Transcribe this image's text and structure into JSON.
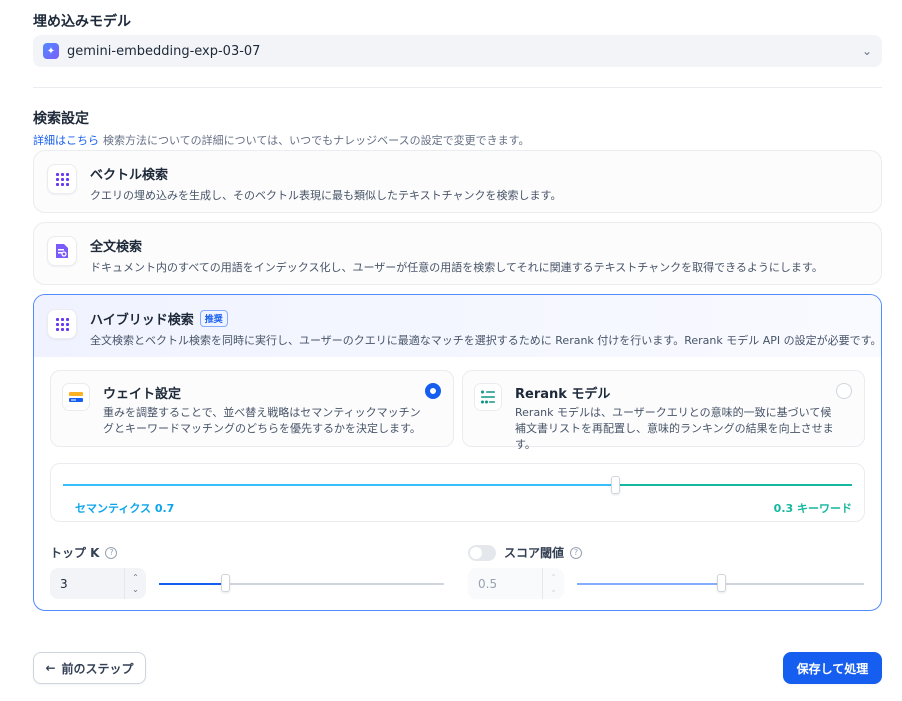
{
  "embedding": {
    "section_title": "埋め込みモデル",
    "model_name": "gemini-embedding-exp-03-07"
  },
  "search_settings": {
    "section_title": "検索設定",
    "learn_more": "詳細はこちら",
    "description": "検索方法についての詳細については、いつでもナレッジベースの設定で変更できます。"
  },
  "options": {
    "vector": {
      "title": "ベクトル検索",
      "description": "クエリの埋め込みを生成し、そのベクトル表現に最も類似したテキストチャンクを検索します。"
    },
    "fulltext": {
      "title": "全文検索",
      "description": "ドキュメント内のすべての用語をインデックス化し、ユーザーが任意の用語を検索してそれに関連するテキストチャンクを取得できるようにします。"
    },
    "hybrid": {
      "title": "ハイブリッド検索",
      "badge": "推奨",
      "description": "全文検索とベクトル検索を同時に実行し、ユーザーのクエリに最適なマッチを選択するために Rerank 付けを行います。Rerank モデル API の設定が必要です。",
      "weight_setting": {
        "title": "ウェイト設定",
        "description": "重みを調整することで、並べ替え戦略はセマンティックマッチングとキーワードマッチングのどちらを優先するかを決定します。",
        "selected": true
      },
      "rerank_model": {
        "title": "Rerank モデル",
        "description": "Rerank モデルは、ユーザークエリとの意味的一致に基づいて候補文書リストを再配置し、意味的ランキングの結果を向上させます。",
        "selected": false
      },
      "weights": {
        "semantic_label": "セマンティクス 0.7",
        "keyword_label": "0.3 キーワード",
        "semantic_value": 0.7,
        "keyword_value": 0.3
      },
      "top_k": {
        "label": "トップ K",
        "value": "3",
        "slider_fraction": 0.23
      },
      "score_threshold": {
        "label": "スコア閾値",
        "value": "0.5",
        "enabled": false,
        "slider_fraction": 0.5
      }
    }
  },
  "footer": {
    "back_label": "前のステップ",
    "save_label": "保存して処理"
  },
  "colors": {
    "primary": "#155eef",
    "semantic": "#0ba5ec",
    "keyword": "#15b79e"
  }
}
